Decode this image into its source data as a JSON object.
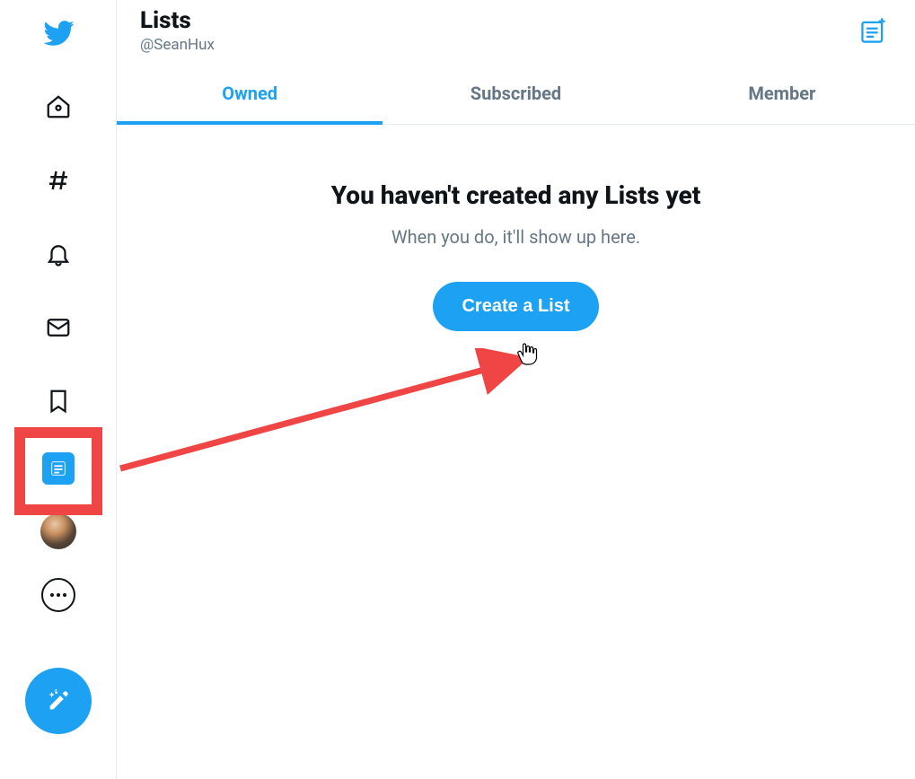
{
  "header": {
    "title": "Lists",
    "handle": "@SeanHux"
  },
  "tabs": {
    "owned": "Owned",
    "subscribed": "Subscribed",
    "member": "Member",
    "active": "owned"
  },
  "empty": {
    "title": "You haven't created any Lists yet",
    "sub": "When you do, it'll show up here.",
    "button": "Create a List"
  },
  "nav": {
    "logo": "twitter-logo",
    "home": "home",
    "explore": "explore",
    "notifications": "notifications",
    "messages": "messages",
    "bookmarks": "bookmarks",
    "lists": "lists",
    "profile": "profile",
    "more": "more",
    "compose": "compose"
  },
  "colors": {
    "accent": "#1da1f2",
    "annotation": "#ef4545"
  }
}
